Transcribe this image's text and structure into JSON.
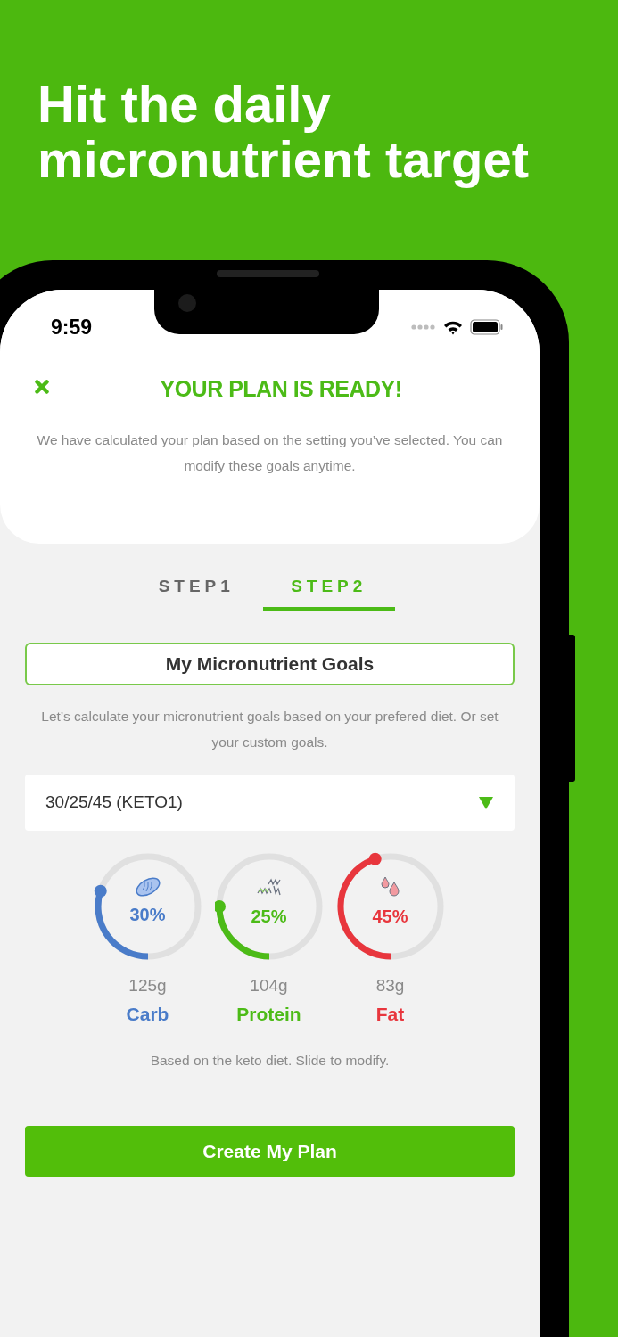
{
  "headline": "Hit the daily micronutrient target",
  "status_bar": {
    "time": "9:59"
  },
  "header": {
    "title": "YOUR PLAN IS READY!",
    "subtitle": "We have calculated your plan based on the setting you’ve selected. You can modify these goals anytime."
  },
  "tabs": [
    {
      "label": "STEP1",
      "selected": false
    },
    {
      "label": "STEP2",
      "selected": true
    }
  ],
  "goals_title": "My Micronutrient Goals",
  "description": "Let’s calculate your micronutrient goals based on your prefered diet. Or set your custom goals.",
  "diet_select": {
    "value": "30/25/45 (KETO1)"
  },
  "macros": [
    {
      "kind": "carb",
      "percent": "30%",
      "grams": "125g",
      "name": "Carb",
      "color": "#4a7cc9",
      "level": 0.3
    },
    {
      "kind": "protein",
      "percent": "25%",
      "grams": "104g",
      "name": "Protein",
      "color": "#4cbb17",
      "level": 0.25
    },
    {
      "kind": "fat",
      "percent": "45%",
      "grams": "83g",
      "name": "Fat",
      "color": "#e8363d",
      "level": 0.45
    }
  ],
  "hint": "Based on the keto diet. Slide to modify.",
  "primary_button": "Create My Plan"
}
